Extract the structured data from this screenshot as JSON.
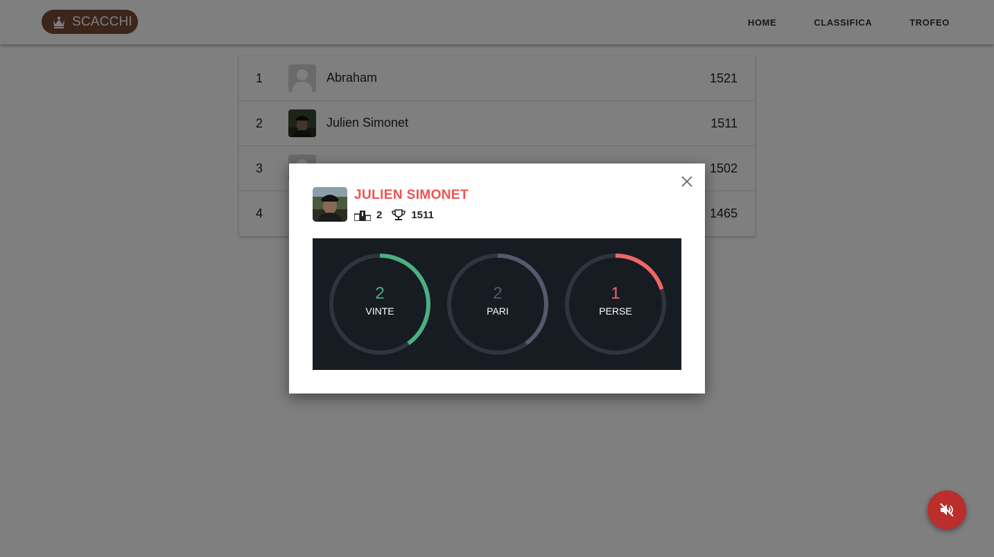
{
  "navbar": {
    "logo_text": "SCACCHI",
    "logo_icon": "crown-icon",
    "links": [
      "HOME",
      "CLASSIFICA",
      "TROFEO"
    ]
  },
  "ranking": [
    {
      "position": "1",
      "name": "Abraham",
      "score": "1521",
      "avatar": "placeholder"
    },
    {
      "position": "2",
      "name": "Julien Simonet",
      "score": "1511",
      "avatar": "photo"
    },
    {
      "position": "3",
      "name": "",
      "score": "1502",
      "avatar": "placeholder"
    },
    {
      "position": "4",
      "name": "",
      "score": "1465",
      "avatar": "placeholder"
    }
  ],
  "modal": {
    "player_name": "JULIEN SIMONET",
    "rank": "2",
    "rank_icon": "podium-icon",
    "score": "1511",
    "score_icon": "trophy-icon",
    "close_icon": "close-icon",
    "stats": [
      {
        "value": "2",
        "label": "VINTE",
        "color": "#4caf80",
        "fraction": 0.4
      },
      {
        "value": "2",
        "label": "PARI",
        "color": "#535a6b",
        "fraction": 0.4
      },
      {
        "value": "1",
        "label": "PERSE",
        "color": "#ef6666",
        "fraction": 0.2
      }
    ]
  },
  "fab": {
    "icon": "volume-off-icon",
    "color": "#e53935"
  },
  "colors": {
    "logo_bg": "#7a4a38",
    "accent_name": "#ef5350",
    "stats_bg": "#171b22",
    "ring_track": "#30343d"
  }
}
